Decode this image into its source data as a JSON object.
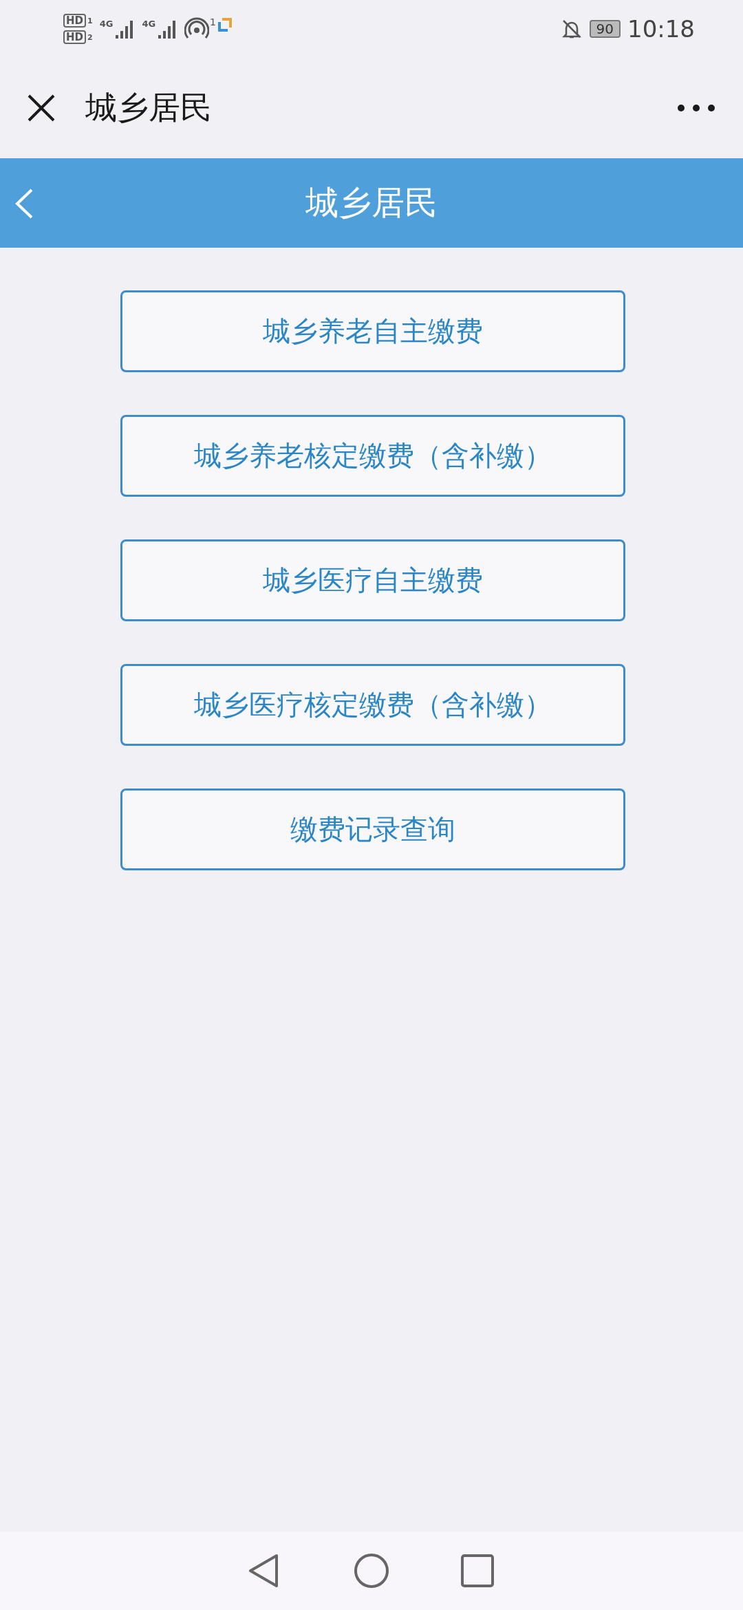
{
  "status_bar": {
    "sims": [
      {
        "label": "HD",
        "slot": "1",
        "network": "4G"
      },
      {
        "label": "HD",
        "slot": "2",
        "network": "4G"
      }
    ],
    "hotspot_count": "1",
    "battery": "90",
    "time": "10:18"
  },
  "browser_header": {
    "title": "城乡居民"
  },
  "page_header": {
    "title": "城乡居民"
  },
  "menu": [
    {
      "label": "城乡养老自主缴费"
    },
    {
      "label": "城乡养老核定缴费（含补缴）"
    },
    {
      "label": "城乡医疗自主缴费"
    },
    {
      "label": "城乡医疗核定缴费（含补缴）"
    },
    {
      "label": "缴费记录查询"
    }
  ]
}
